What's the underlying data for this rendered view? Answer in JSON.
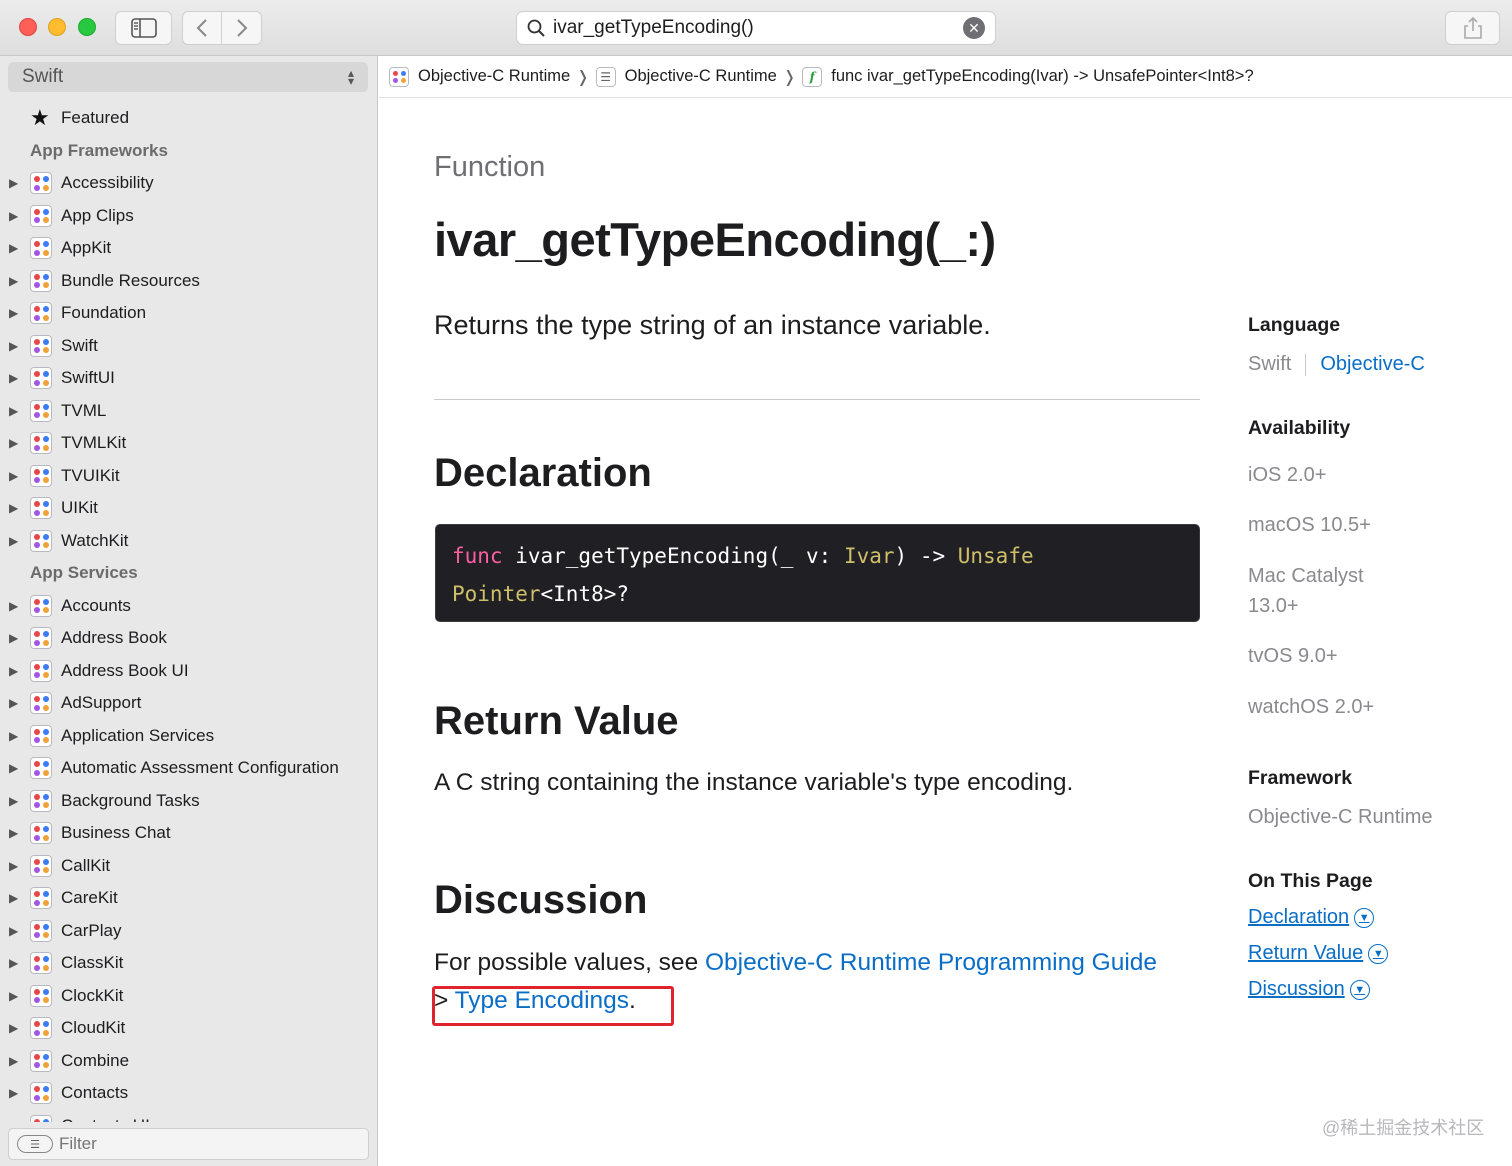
{
  "window": {
    "search_query": "ivar_getTypeEncoding()"
  },
  "sidebar": {
    "language_selector": "Swift",
    "featured_label": "Featured",
    "sections": [
      {
        "header": "App Frameworks",
        "items": [
          "Accessibility",
          "App Clips",
          "AppKit",
          "Bundle Resources",
          "Foundation",
          "Swift",
          "SwiftUI",
          "TVML",
          "TVMLKit",
          "TVUIKit",
          "UIKit",
          "WatchKit"
        ]
      },
      {
        "header": "App Services",
        "items": [
          "Accounts",
          "Address Book",
          "Address Book UI",
          "AdSupport",
          "Application Services",
          "Automatic Assessment Configuration",
          "Background Tasks",
          "Business Chat",
          "CallKit",
          "CareKit",
          "CarPlay",
          "ClassKit",
          "ClockKit",
          "CloudKit",
          "Combine",
          "Contacts",
          "Contacts UI"
        ]
      }
    ],
    "filter_placeholder": "Filter"
  },
  "breadcrumb": [
    {
      "label": "Objective-C Runtime",
      "icon": "framework-icon"
    },
    {
      "label": "Objective-C Runtime",
      "icon": "list-icon"
    },
    {
      "label": "func ivar_getTypeEncoding(Ivar) -> UnsafePointer<Int8>?",
      "icon": "function-icon"
    }
  ],
  "doc": {
    "kind": "Function",
    "title": "ivar_getTypeEncoding(_:)",
    "abstract": "Returns the type string of an instance variable.",
    "declaration_heading": "Declaration",
    "code": {
      "keyword": "func",
      "name": " ivar_getTypeEncoding(_ v: ",
      "param_type": "Ivar",
      "arrow": ") -> ",
      "return_type_line1": "Unsafe",
      "return_type_line2": "Pointer",
      "generic": "<Int8>?",
      "generic_type": "Int8"
    },
    "return_heading": "Return Value",
    "return_text": "A C string containing the instance variable's type encoding.",
    "discussion_heading": "Discussion",
    "discussion_prefix": "For possible values, see ",
    "discussion_link1": "Objective-C Runtime Programming Guide",
    "discussion_sep": "> ",
    "discussion_link2": "Type Encodings",
    "discussion_suffix": "."
  },
  "aside": {
    "language_heading": "Language",
    "language_swift": "Swift",
    "language_objc": "Objective-C",
    "availability_heading": "Availability",
    "availability": [
      "iOS 2.0+",
      "macOS 10.5+",
      "Mac Catalyst",
      "13.0+",
      "tvOS 9.0+",
      "watchOS 2.0+"
    ],
    "framework_heading": "Framework",
    "framework": "Objective-C Runtime",
    "on_this_page_heading": "On This Page",
    "on_this_page": [
      "Declaration",
      "Return Value",
      "Discussion"
    ]
  },
  "watermark": "@稀土掘金技术社区",
  "colors": {
    "link": "#0a6ec7",
    "highlight": "#e0242e",
    "code_bg": "#1f1f24",
    "code_keyword": "#fc5fa3",
    "code_type": "#d0bf69"
  }
}
